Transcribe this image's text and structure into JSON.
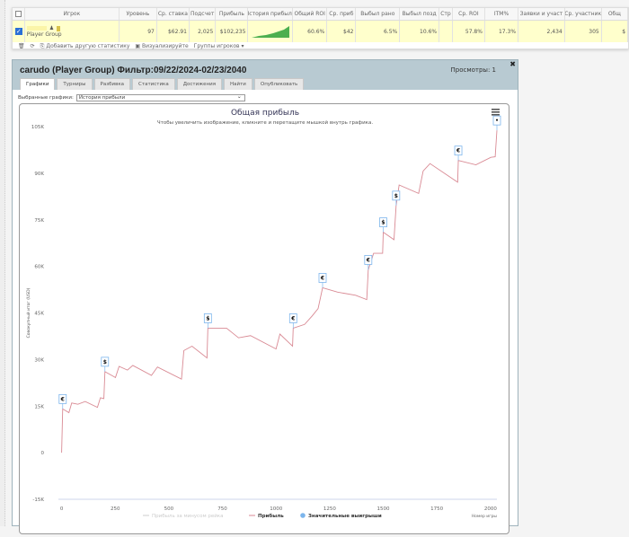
{
  "table": {
    "headers": [
      "Игрок",
      "Уровень",
      "Ср. ставка",
      "Подсчет",
      "Прибыль",
      "История прибыли",
      "Общий ROI",
      "Ср. приб",
      "Выбыл рано",
      "Выбыл позд",
      "Стр",
      "Ср. ROI",
      "ITM%",
      "Заявки и участ",
      "Ср. участник",
      "Общ"
    ],
    "row": {
      "player": "Player Group",
      "level": "97",
      "avg_stake": "$62.91",
      "count": "2,025",
      "profit": "$102,235",
      "total_roi": "60.6%",
      "avg_profit": "$42",
      "early": "6.5%",
      "late": "10.6%",
      "str": "",
      "avg_roi": "57.8%",
      "itm": "17.3%",
      "entries": "2,434",
      "avg_players": "305",
      "total": "$"
    },
    "checked": true,
    "toolbar": {
      "add_stats": "Добавить другую статистику",
      "visualize": "Визуализируйте",
      "groups": "Группы игроков"
    }
  },
  "dialog": {
    "title": "carudo (Player Group) Фильтр:09/22/2024-02/23/2040",
    "views": "Просмотры: 1",
    "tabs": [
      "Графики",
      "Турниры",
      "Разбивка",
      "Статистика",
      "Достижения",
      "Найти",
      "Опубликовать"
    ],
    "active_tab": "Графики",
    "select_label": "Выбранные графики:",
    "select_value": "История прибыли"
  },
  "chart_data": {
    "type": "line",
    "title": "Общая прибыль",
    "subtitle": "Чтобы увеличить изображение, кликните и перетащите мышкой внутрь графика.",
    "xlabel": "Номер игры",
    "ylabel": "Совокупный итог (USD)",
    "xlim": [
      -15,
      2030
    ],
    "ylim": [
      -15000,
      105000
    ],
    "xticks": [
      0,
      250,
      500,
      750,
      1000,
      1250,
      1500,
      1750,
      2000
    ],
    "yticks": [
      -15000,
      0,
      15000,
      30000,
      45000,
      60000,
      75000,
      90000,
      105000
    ],
    "ytick_labels": [
      "-15K",
      "0",
      "15K",
      "30K",
      "45K",
      "60K",
      "75K",
      "90K",
      "105K"
    ],
    "grid": false,
    "legend_position": "bottom",
    "legend": [
      "Прибыль за минусом рейка",
      "Прибыль",
      "Значительные выигрыши"
    ],
    "colors": {
      "profit": "#d98a94",
      "rake": "#cccccc",
      "wins": "#7cb5ec"
    },
    "series": [
      {
        "name": "Прибыль",
        "x": [
          0,
          5,
          34,
          47,
          76,
          110,
          167,
          181,
          197,
          202,
          251,
          268,
          307,
          332,
          419,
          447,
          559,
          570,
          608,
          678,
          682,
          769,
          825,
          881,
          1000,
          1018,
          1077,
          1080,
          1133,
          1168,
          1196,
          1217,
          1287,
          1371,
          1423,
          1430,
          1455,
          1497,
          1500,
          1550,
          1560,
          1574,
          1665,
          1686,
          1718,
          1847,
          1850,
          1932,
          2002,
          2022,
          2030
        ],
        "y": [
          0,
          14100,
          12900,
          16000,
          15600,
          16500,
          14600,
          17700,
          17400,
          26100,
          24200,
          27800,
          26600,
          28100,
          24900,
          27600,
          23700,
          32900,
          34300,
          30500,
          40100,
          40100,
          37000,
          37700,
          33400,
          38200,
          34300,
          40100,
          41300,
          44000,
          46400,
          53100,
          51700,
          50700,
          49300,
          58900,
          64200,
          64200,
          71000,
          68600,
          79600,
          86200,
          83500,
          90700,
          93100,
          87100,
          94100,
          92700,
          95100,
          95300,
          103800
        ]
      }
    ],
    "big_wins": [
      {
        "x": 5,
        "symbol": "€"
      },
      {
        "x": 202,
        "symbol": "$"
      },
      {
        "x": 682,
        "symbol": "$"
      },
      {
        "x": 1080,
        "symbol": "€"
      },
      {
        "x": 1217,
        "symbol": "€"
      },
      {
        "x": 1430,
        "symbol": "€"
      },
      {
        "x": 1500,
        "symbol": "$"
      },
      {
        "x": 1560,
        "symbol": "$"
      },
      {
        "x": 1850,
        "symbol": "€"
      },
      {
        "x": 2030,
        "symbol": "•"
      }
    ]
  },
  "icons": {
    "menu": "hamburger-icon",
    "close": "close-icon"
  }
}
